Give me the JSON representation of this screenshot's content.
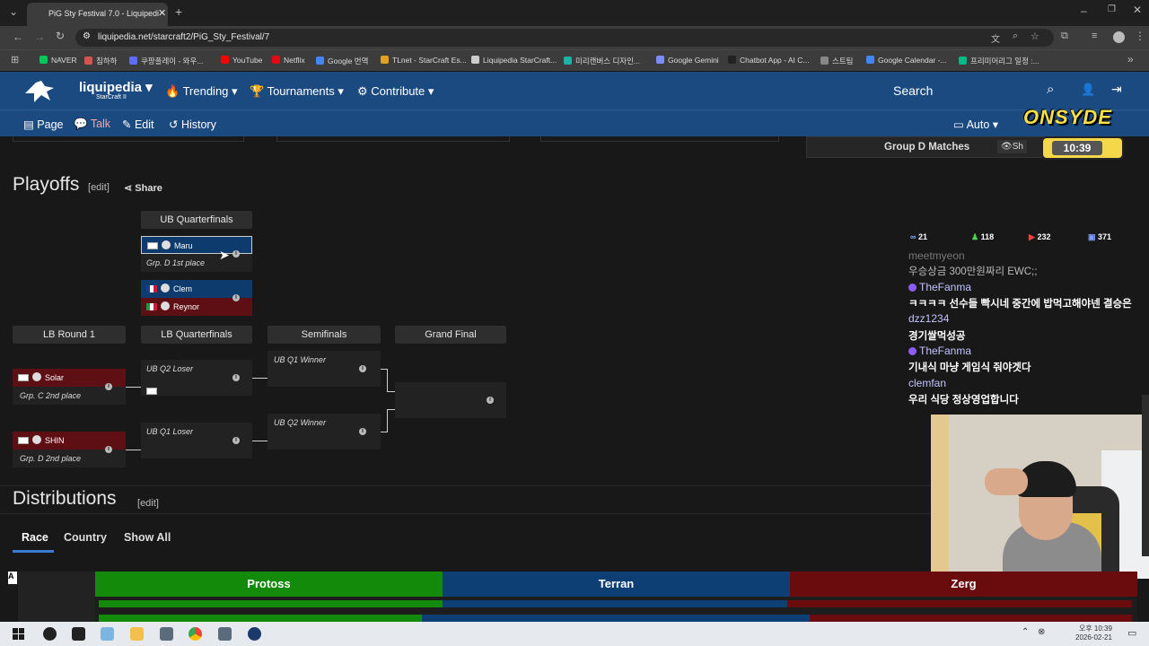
{
  "browser": {
    "tab_title": "PiG Sty Festival 7.0 - Liquipedi",
    "url": "liquipedia.net/starcraft2/PiG_Sty_Festival/7",
    "bookmarks": [
      "NAVER",
      "침하하",
      "쿠팡플레이 - 와우...",
      "YouTube",
      "Netflix",
      "Google 번역",
      "TLnet - StarCraft Es...",
      "Liquipedia StarCraft...",
      "미리캔버스 디자인...",
      "Google Gemini",
      "Chatbot App - AI C...",
      "스트팀",
      "Google Calendar -...",
      "프리미어리그 일정 :..."
    ]
  },
  "nav": {
    "brand": "liquipedia",
    "brand_sub": "StarCraft II",
    "trending": "Trending",
    "tournaments": "Tournaments",
    "contribute": "Contribute",
    "search": "Search",
    "page": "Page",
    "talk": "Talk",
    "edit": "Edit",
    "history": "History",
    "auto": "Auto"
  },
  "group_d": {
    "label": "Group D Matches",
    "show": "Sh"
  },
  "overlay": {
    "logo": "ONSYDE",
    "timer": "10:39"
  },
  "playoffs": {
    "title": "Playoffs",
    "edit": "edit",
    "share": "Share",
    "headers": {
      "ub_qf": "UB Quarterfinals",
      "lb_r1": "LB Round 1",
      "lb_qf": "LB Quarterfinals",
      "semis": "Semifinals",
      "final": "Grand Final"
    },
    "ub_match1": {
      "player": "Maru",
      "note": "Grp. D 1st place"
    },
    "ub_match2": {
      "p1": "Clem",
      "p2": "Reynor"
    },
    "lb1_m1": {
      "player": "Solar",
      "note": "Grp. C 2nd place"
    },
    "lb1_m2": {
      "player": "SHIN",
      "note": "Grp. D 2nd place"
    },
    "lbqf_m1": {
      "label": "UB Q2 Loser"
    },
    "lbqf_m2": {
      "label": "UB Q1 Loser"
    },
    "semi_m1": {
      "label": "UB Q1 Winner"
    },
    "semi_m2": {
      "label": "UB Q2 Winner"
    }
  },
  "chat": {
    "stats": [
      "21",
      "118",
      "232",
      "371"
    ],
    "partial_name": "meetmyeon",
    "partial_msg": "우승상금 300만원짜리 EWC;;",
    "messages": [
      {
        "name": "TheFanma",
        "text": "ㅋㅋㅋㅋ 선수들 빡시네 중간에 밥먹고해야넨 결승은"
      },
      {
        "name": "dzz1234",
        "text": "경기쌀먹성공"
      },
      {
        "name": "TheFanma",
        "text": "기내식 마냥 게임식 줘야겟다"
      },
      {
        "name": "clemfan",
        "text": "우리 식당 정상영업합니다"
      }
    ]
  },
  "distributions": {
    "title": "Distributions",
    "edit": "edit",
    "tabs": [
      "Race",
      "Country",
      "Show All"
    ],
    "races": [
      "Protoss",
      "Terran",
      "Zerg"
    ]
  },
  "colors": {
    "protoss": "#138a0a",
    "terran": "#0e3f74",
    "zerg": "#6a0b0e",
    "nav": "#1b4a80"
  },
  "taskbar": {
    "time": "오후 10:39",
    "date": "2026-02-21"
  }
}
